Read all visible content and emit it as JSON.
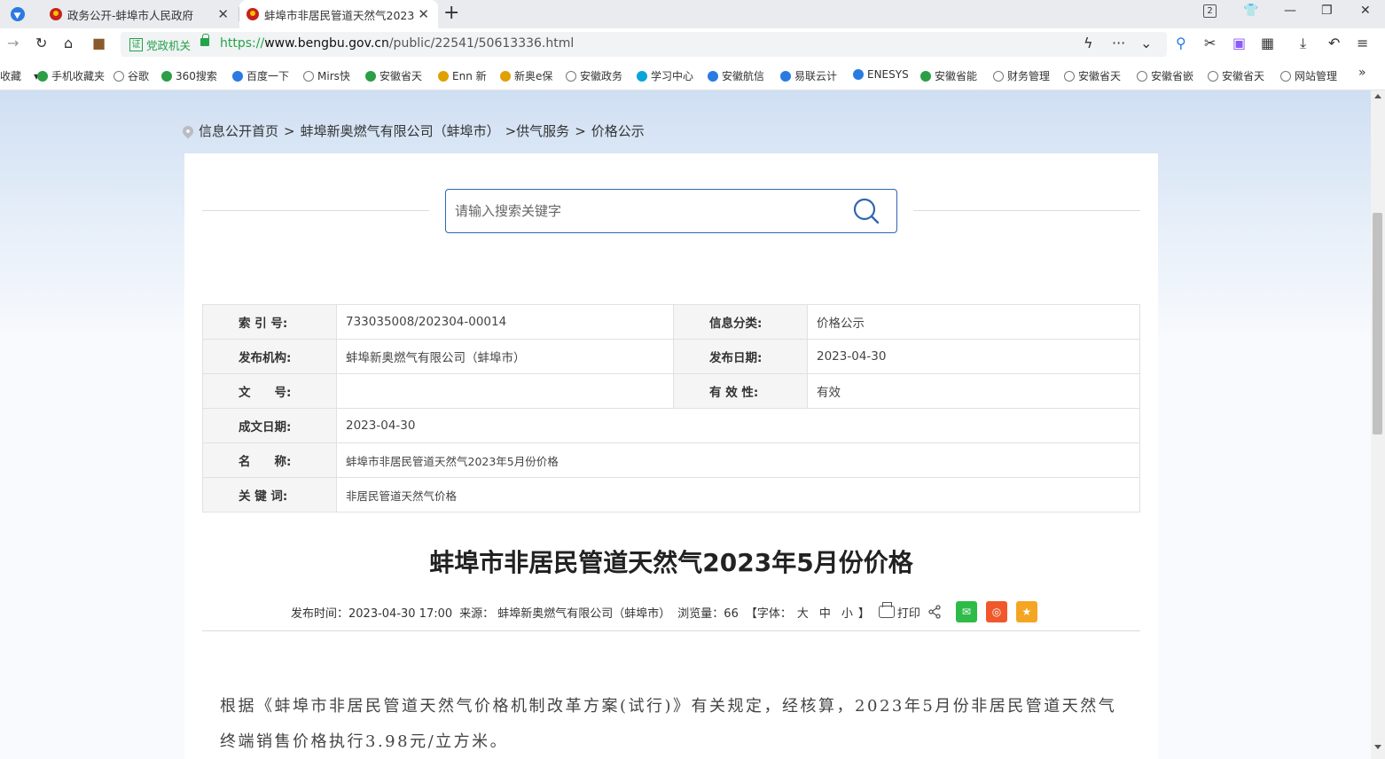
{
  "browser": {
    "tabs": [
      {
        "label": "政务公开-蚌埠市人民政府",
        "active": false
      },
      {
        "label": "蚌埠市非居民管道天然气2023",
        "active": true
      }
    ],
    "tab_count": "2",
    "address": {
      "gov_badge": "党政机关",
      "gov_badge_char": "证",
      "url_proto": "https://",
      "url_host": "www.bengbu.gov.cn",
      "url_path": "/public/22541/50613336.html"
    },
    "bookmarks": [
      "收藏",
      "手机收藏夹",
      "谷歌",
      "360搜索",
      "百度一下",
      "Mirs快",
      "安徽省天",
      "Enn 新",
      "新奥e保",
      "安徽政务",
      "学习中心",
      "安徽航信",
      "易联云计",
      "ENESYS",
      "安徽省能",
      "财务管理",
      "安徽省天",
      "安徽省嵌",
      "安徽省天",
      "网站管理"
    ]
  },
  "page": {
    "breadcrumb": [
      "信息公开首页",
      ">",
      "蚌埠新奥燃气有限公司（蚌埠市）",
      ">供气服务",
      ">",
      "价格公示"
    ],
    "search": {
      "placeholder": "请输入搜索关键字"
    },
    "meta": {
      "index_label": "索 引 号:",
      "index_value": "733035008/202304-00014",
      "category_label": "信息分类:",
      "category_value": "价格公示",
      "publisher_label": "发布机构:",
      "publisher_value": "蚌埠新奥燃气有限公司（蚌埠市）",
      "pubdate_label": "发布日期:",
      "pubdate_value": "2023-04-30",
      "docno_label": "文　　号:",
      "docno_value": "",
      "validity_label": "有 效 性:",
      "validity_value": "有效",
      "created_label": "成文日期:",
      "created_value": "2023-04-30",
      "name_label": "名　　称:",
      "name_value": "蚌埠市非居民管道天然气2023年5月份价格",
      "keywords_label": "关 键 词:",
      "keywords_value": "非居民管道天然气价格"
    },
    "title": "蚌埠市非居民管道天然气2023年5月份价格",
    "info": {
      "pubtime": "发布时间：2023-04-30 17:00",
      "source": "来源：  蚌埠新奥燃气有限公司（蚌埠市）",
      "views": "浏览量：66",
      "font_label": "【字体：",
      "font_large": "大",
      "font_mid": "中",
      "font_small": "小",
      "font_end": "】",
      "print": "打印"
    },
    "body": "根据《蚌埠市非居民管道天然气价格机制改革方案(试行)》有关规定，经核算，2023年5月份非居民管道天然气终端销售价格执行3.98元/立方米。"
  }
}
